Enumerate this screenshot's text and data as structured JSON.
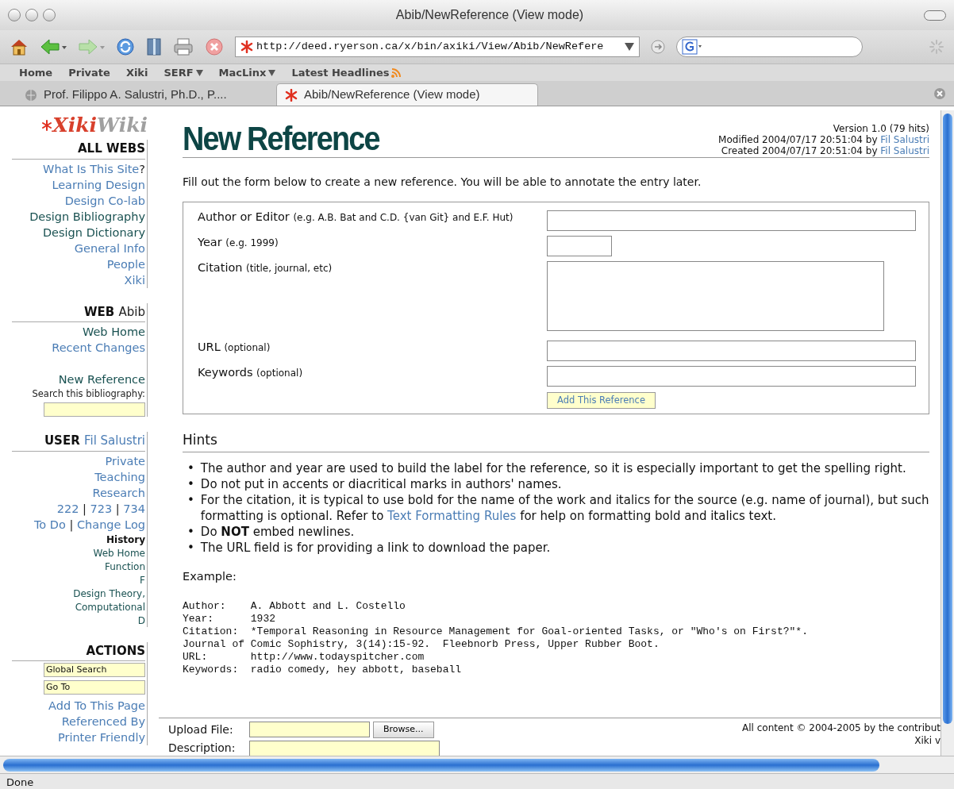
{
  "window": {
    "title": "Abib/NewReference (View mode)"
  },
  "toolbar": {
    "url": "http://deed.ryerson.ca/x/bin/axiki/View/Abib/NewRefere"
  },
  "bookmarks": [
    {
      "label": "Home",
      "menu": false
    },
    {
      "label": "Private",
      "menu": false
    },
    {
      "label": "Xiki",
      "menu": false
    },
    {
      "label": "SERF",
      "menu": true
    },
    {
      "label": "MacLinx",
      "menu": true
    },
    {
      "label": "Latest Headlines",
      "menu": false,
      "feed": true
    }
  ],
  "tabs": [
    {
      "label": "Prof. Filippo A. Salustri, Ph.D., P....",
      "selected": false
    },
    {
      "label": "Abib/NewReference (View mode)",
      "selected": true
    }
  ],
  "sidebar": {
    "logo": [
      "Xiki",
      "Wiki"
    ],
    "sections": [
      {
        "heading": "ALL WEBS",
        "items": [
          {
            "kind": "line",
            "parts": [
              {
                "text": "What Is This Site",
                "kind": "link"
              },
              {
                "text": "?",
                "kind": "plain"
              }
            ]
          },
          {
            "kind": "line",
            "parts": [
              {
                "text": "Learning Design",
                "kind": "link"
              }
            ]
          },
          {
            "kind": "line",
            "parts": [
              {
                "text": "Design Co-lab",
                "kind": "link"
              }
            ]
          },
          {
            "kind": "line",
            "parts": [
              {
                "text": "Design Bibliography",
                "kind": "visited"
              }
            ]
          },
          {
            "kind": "line",
            "parts": [
              {
                "text": "Design Dictionary",
                "kind": "visited"
              }
            ]
          },
          {
            "kind": "line",
            "parts": [
              {
                "text": "General Info",
                "kind": "link"
              }
            ]
          },
          {
            "kind": "line",
            "parts": [
              {
                "text": "People",
                "kind": "link"
              }
            ]
          },
          {
            "kind": "line",
            "parts": [
              {
                "text": "Xiki",
                "kind": "link"
              }
            ]
          }
        ]
      },
      {
        "heading": "WEB",
        "extra": {
          "text": "Abib",
          "kind": "plain"
        },
        "items": [
          {
            "kind": "line",
            "parts": [
              {
                "text": "Web Home",
                "kind": "visited"
              }
            ]
          },
          {
            "kind": "line",
            "parts": [
              {
                "text": "Recent Changes",
                "kind": "link"
              }
            ]
          },
          {
            "kind": "line",
            "gap": true,
            "parts": [
              {
                "text": "New Reference",
                "kind": "visited"
              }
            ]
          },
          {
            "kind": "label",
            "text": "Search this bibliography:"
          },
          {
            "kind": "field"
          }
        ]
      },
      {
        "heading": "USER",
        "extra": {
          "text": "Fil Salustri",
          "kind": "link"
        },
        "items": [
          {
            "kind": "line",
            "parts": [
              {
                "text": "Private",
                "kind": "link"
              }
            ]
          },
          {
            "kind": "line",
            "parts": [
              {
                "text": "Teaching",
                "kind": "link"
              }
            ]
          },
          {
            "kind": "line",
            "parts": [
              {
                "text": "Research",
                "kind": "link"
              }
            ]
          },
          {
            "kind": "line",
            "parts": [
              {
                "text": "222",
                "kind": "link"
              },
              {
                "text": " | ",
                "kind": "plain"
              },
              {
                "text": "723",
                "kind": "link"
              },
              {
                "text": " | ",
                "kind": "plain"
              },
              {
                "text": "734",
                "kind": "link"
              }
            ]
          },
          {
            "kind": "line",
            "parts": [
              {
                "text": "To Do",
                "kind": "link"
              },
              {
                "text": " | ",
                "kind": "plain"
              },
              {
                "text": "Change Log",
                "kind": "link"
              }
            ]
          },
          {
            "kind": "line",
            "parts": [
              {
                "text": "History",
                "kind": "small-bold"
              }
            ]
          },
          {
            "kind": "line",
            "parts": [
              {
                "text": "Web Home",
                "kind": "small-visited"
              }
            ]
          },
          {
            "kind": "line",
            "parts": [
              {
                "text": "Function",
                "kind": "small-visited"
              }
            ]
          },
          {
            "kind": "line",
            "parts": [
              {
                "text": "F",
                "kind": "small-visited"
              }
            ]
          },
          {
            "kind": "line",
            "parts": [
              {
                "text": "Design Theory,",
                "kind": "small-visited"
              }
            ]
          },
          {
            "kind": "line",
            "parts": [
              {
                "text": "Computational",
                "kind": "small-visited"
              }
            ]
          },
          {
            "kind": "line",
            "parts": [
              {
                "text": "D",
                "kind": "small-visited"
              }
            ]
          }
        ]
      },
      {
        "heading": "ACTIONS",
        "items": [
          {
            "kind": "field",
            "value": "Global Search"
          },
          {
            "kind": "field",
            "value": "Go To"
          },
          {
            "kind": "line",
            "parts": [
              {
                "text": "Add To This Page",
                "kind": "link"
              }
            ]
          },
          {
            "kind": "line",
            "parts": [
              {
                "text": "Referenced By",
                "kind": "link"
              }
            ]
          },
          {
            "kind": "line",
            "parts": [
              {
                "text": "Printer Friendly",
                "kind": "link"
              }
            ]
          }
        ]
      }
    ]
  },
  "page": {
    "title": "New Reference",
    "meta": [
      {
        "text": "Version 1.0 (79 hits)"
      },
      {
        "text": "Modified 2004/07/17 20:51:04 by",
        "link": "Fil Salustri"
      },
      {
        "text": "Created 2004/07/17 20:51:04 by",
        "link": "Fil Salustri"
      }
    ],
    "intro": "Fill out the form below to create a new reference. You will be able to annotate the entry later.",
    "form": {
      "fields": [
        {
          "label": "Author or Editor",
          "hint": "(e.g. A.B. Bat and C.D. {van Git} and E.F. Hut)",
          "kind": "text"
        },
        {
          "label": "Year",
          "hint": "(e.g. 1999)",
          "kind": "short"
        },
        {
          "label": "Citation",
          "hint": "(title, journal, etc)",
          "kind": "textarea"
        },
        {
          "label": "URL",
          "hint": "(optional)",
          "kind": "text"
        },
        {
          "label": "Keywords",
          "hint": "(optional)",
          "kind": "text"
        }
      ],
      "submit": "Add This Reference"
    },
    "hints": {
      "title": "Hints",
      "items": [
        {
          "bullet": "•",
          "parts": [
            {
              "text": "The author and year are used to build the label for the reference, so it is especially important to get the spelling right.",
              "link": false
            }
          ]
        },
        {
          "bullet": "•",
          "parts": [
            {
              "text": "Do not put in accents or diacritical marks in authors' names.",
              "link": false
            }
          ]
        },
        {
          "bullet": "•",
          "parts": [
            {
              "text": "For the citation, it is typical to use bold for the name of the work and italics for the source (e.g. name of journal), but such formatting is optional. Refer to ",
              "link": false
            },
            {
              "text": "Text Formatting Rules",
              "link": true
            },
            {
              "text": " for help on formatting bold and italics text.",
              "link": false
            }
          ]
        },
        {
          "bullet": "•",
          "parts": [
            {
              "text": "Do **NOT** embed newlines.",
              "link": false
            }
          ]
        },
        {
          "bullet": "•",
          "parts": [
            {
              "text": "The URL field is for providing a link to download the paper.",
              "link": false
            }
          ]
        }
      ]
    },
    "example": {
      "label": "Example:",
      "lines": [
        "Author:    A. Abbott and L. Costello",
        "Year:      1932",
        "Citation:  *Temporal Reasoning in Resource Management for Goal-oriented Tasks, or \"Who's on First?\"*.",
        "Journal of Comic Sophistry, 3(14):15-92.  Fleebnorb Press, Upper Rubber Boot.",
        "URL:       http://www.todayspitcher.com",
        "Keywords:  radio comedy, hey abbott, baseball"
      ]
    }
  },
  "footer": {
    "upload_label": "Upload File:",
    "browse": "Browse...",
    "description_label": "Description:",
    "notice": [
      "All content © 2004-2005 by the contribut",
      "Xiki v"
    ]
  },
  "status_bar": "Done"
}
